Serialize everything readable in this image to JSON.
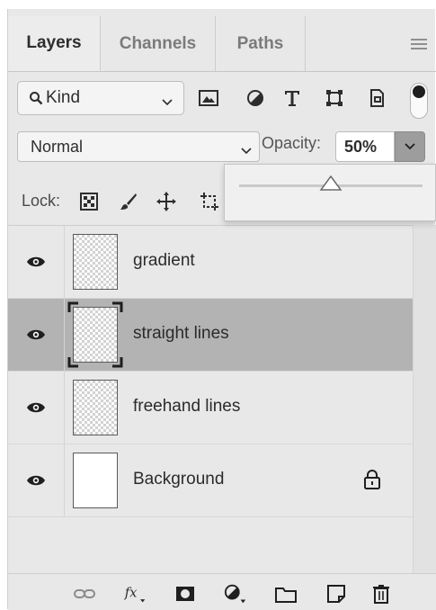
{
  "tabs": [
    {
      "label": "Layers",
      "active": true
    },
    {
      "label": "Channels",
      "active": false
    },
    {
      "label": "Paths",
      "active": false
    }
  ],
  "filter": {
    "kind_label": "Kind",
    "icons": [
      "pixel-filter-icon",
      "adjustment-filter-icon",
      "type-filter-icon",
      "shape-filter-icon",
      "smart-object-filter-icon"
    ]
  },
  "blend": {
    "mode": "Normal",
    "opacity_label": "Opacity:",
    "opacity_value": "50%",
    "slider_value": 0.5
  },
  "lock": {
    "label": "Lock:",
    "icons": [
      "lock-transparent-pixels-icon",
      "lock-image-pixels-icon",
      "lock-position-icon",
      "lock-artboard-icon"
    ]
  },
  "layers": [
    {
      "name": "gradient",
      "visible": true,
      "selected": false,
      "thumb": "transparent",
      "locked": false
    },
    {
      "name": "straight lines",
      "visible": true,
      "selected": true,
      "thumb": "transparent",
      "locked": false
    },
    {
      "name": "freehand lines",
      "visible": true,
      "selected": false,
      "thumb": "transparent",
      "locked": false
    },
    {
      "name": "Background",
      "visible": true,
      "selected": false,
      "thumb": "white",
      "locked": true
    }
  ],
  "footer_icons": [
    "link-layers-icon",
    "fx-icon",
    "add-mask-icon",
    "adjustment-layer-icon",
    "new-group-icon",
    "new-layer-icon",
    "delete-layer-icon"
  ],
  "colors": {
    "panel_bg": "#e8e8e8",
    "selected_row": "#b3b3b3",
    "opacity_dropdown": "#9d9d9d"
  }
}
